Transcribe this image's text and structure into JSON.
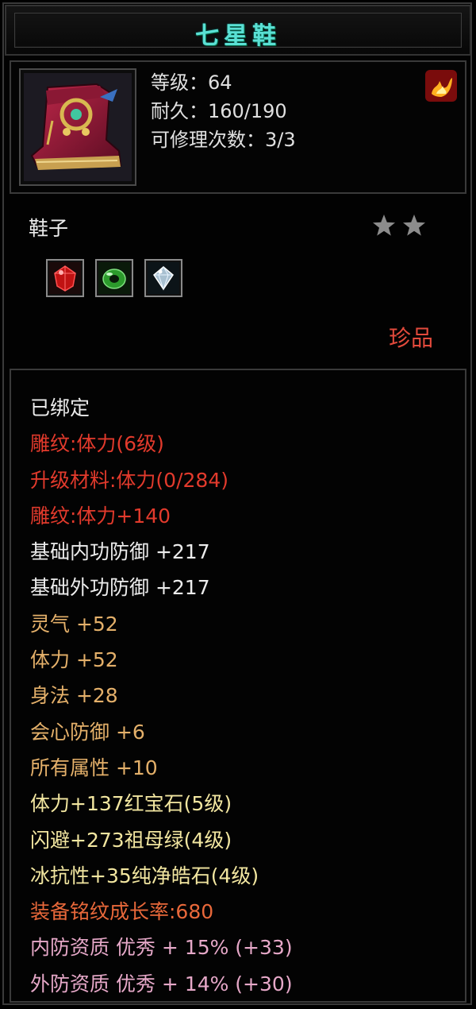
{
  "item": {
    "name": "七星鞋",
    "level": "等级：64",
    "durability": "耐久：160/190",
    "repairs": "可修理次数：3/3",
    "type": "鞋子",
    "stars": 2,
    "quality": "珍品"
  },
  "gems": [
    {
      "icon": "ruby-gem-icon",
      "color": "#d01818"
    },
    {
      "icon": "emerald-gem-icon",
      "color": "#3aa838"
    },
    {
      "icon": "diamond-gem-icon",
      "color": "#c8d8e8"
    }
  ],
  "attributes": [
    {
      "text": "已绑定",
      "color": "white"
    },
    {
      "text": "雕纹:体力(6级)",
      "color": "red"
    },
    {
      "text": "升级材料:体力(0/284)",
      "color": "red"
    },
    {
      "text": "雕纹:体力+140",
      "color": "red"
    },
    {
      "text": "基础内功防御 +217",
      "color": "white"
    },
    {
      "text": "基础外功防御 +217",
      "color": "white"
    },
    {
      "text": "灵气 +52",
      "color": "tan"
    },
    {
      "text": "体力 +52",
      "color": "tan"
    },
    {
      "text": "身法 +28",
      "color": "tan"
    },
    {
      "text": "会心防御 +6",
      "color": "tan"
    },
    {
      "text": "所有属性 +10",
      "color": "tan"
    },
    {
      "text": "体力+137红宝石(5级)",
      "color": "yellow"
    },
    {
      "text": "闪避+273祖母绿(4级)",
      "color": "yellow"
    },
    {
      "text": "冰抗性+35纯净皓石(4级)",
      "color": "yellow"
    },
    {
      "text": "装备铭纹成长率:680",
      "color": "orange"
    },
    {
      "text": "内防资质 优秀 + 15% (+33)",
      "color": "pink"
    },
    {
      "text": "外防资质 优秀 + 14% (+30)",
      "color": "pink"
    }
  ]
}
